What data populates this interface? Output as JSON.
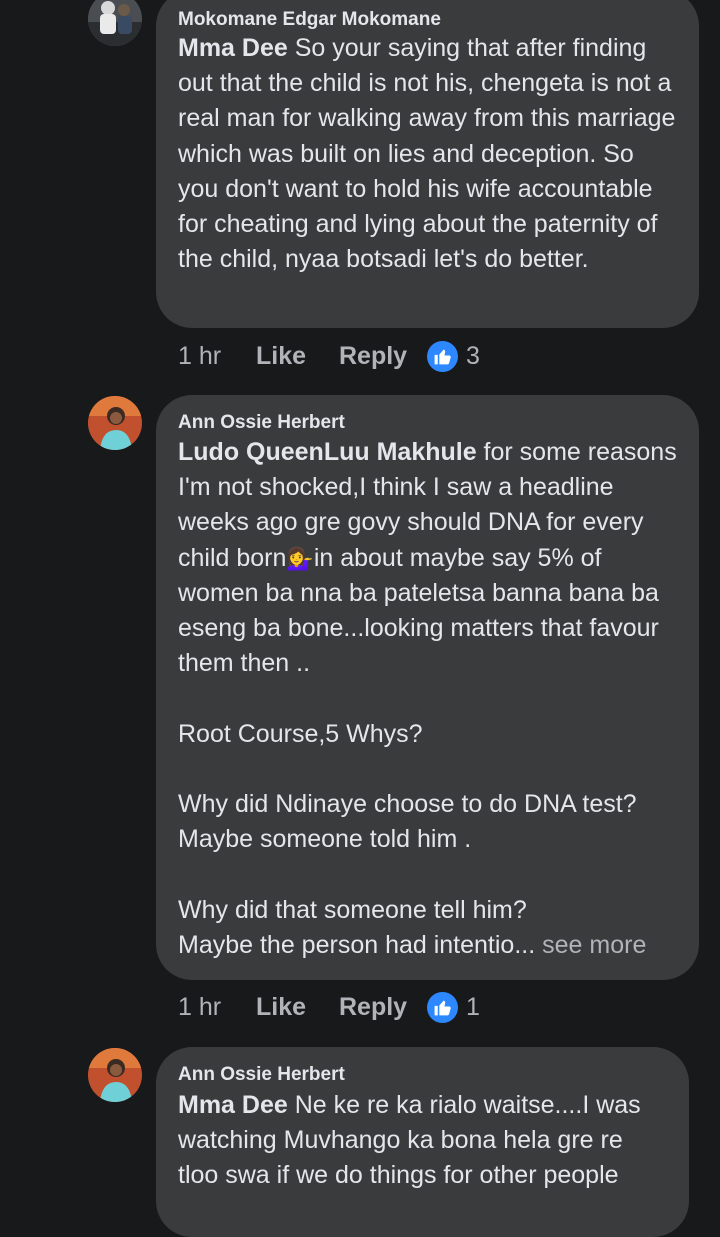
{
  "comments": [
    {
      "author": "Mokomane Edgar Mokomane",
      "mention": "Mma Dee",
      "text": " So your saying that after finding out that the child is not his, chengeta is not a real man for walking away from this marriage which was built on lies and deception. So you don't want to hold his wife accountable for cheating and lying about the paternity of the child, nyaa botsadi let's do better.",
      "time": "1 hr",
      "like_label": "Like",
      "reply_label": "Reply",
      "reaction_count": "3"
    },
    {
      "author": "Ann Ossie Herbert",
      "mention": "Ludo QueenLuu Makhule",
      "text_before_emoji": " for some reasons I'm not shocked,I think I saw a headline weeks ago gre govy should DNA for every child born",
      "emoji": "💁‍♀️",
      "text_after_emoji": "in about maybe say 5% of women ba nna ba pateletsa banna bana ba eseng ba bone...looking matters that favour them then ..\n\nRoot Course,5 Whys?\n\nWhy did Ndinaye choose to do DNA test?\nMaybe someone told him .\n\nWhy did that someone tell him?\nMaybe the person had intentio...",
      "see_more": " see more",
      "time": "1 hr",
      "like_label": "Like",
      "reply_label": "Reply",
      "reaction_count": "1"
    },
    {
      "author": "Ann Ossie Herbert",
      "mention": "Mma Dee",
      "text": " Ne ke re ka rialo waitse....I was watching Muvhango ka bona hela gre re tloo swa if we do things for other people"
    }
  ],
  "icons": {
    "reaction": "thumbs-up-icon",
    "reaction_color": "#2d88ff"
  }
}
